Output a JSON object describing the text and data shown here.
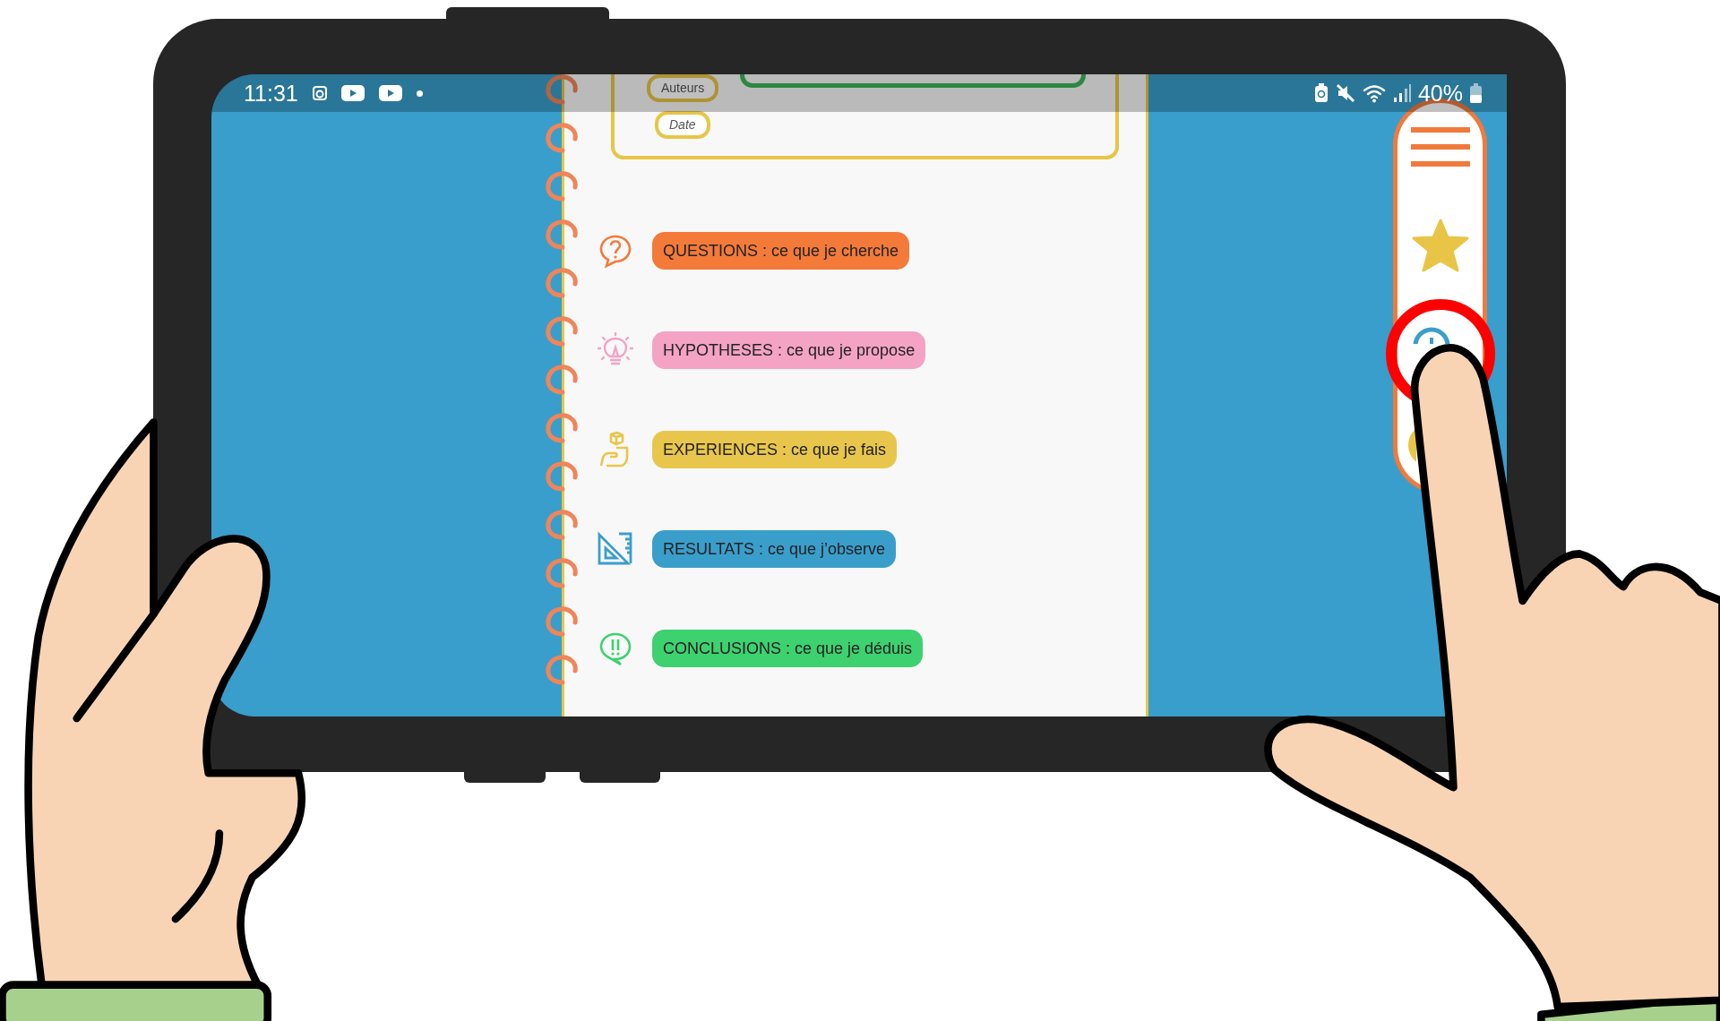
{
  "status_bar": {
    "time": "11:31",
    "battery": "40%"
  },
  "header": {
    "fields": [
      {
        "label": "Auteurs",
        "italic": false
      },
      {
        "label": "Date",
        "italic": true
      }
    ]
  },
  "steps": [
    {
      "kind": "question",
      "label": "QUESTIONS : ce que je cherche",
      "color": "#f47a3a"
    },
    {
      "kind": "idea",
      "label": "HYPOTHESES : ce que je propose",
      "color": "#f4a3c4"
    },
    {
      "kind": "experiment",
      "label": "EXPERIENCES : ce que je fais",
      "color": "#e8c64b"
    },
    {
      "kind": "results",
      "label": "RESULTATS : ce que j’observe",
      "color": "#3a9ecb"
    },
    {
      "kind": "conclusion",
      "label": "CONCLUSIONS : ce que je déduis",
      "color": "#3dd170"
    }
  ],
  "sidebar": {
    "items": [
      {
        "kind": "menu",
        "highlighted": false
      },
      {
        "kind": "star",
        "highlighted": false
      },
      {
        "kind": "add",
        "highlighted": true
      },
      {
        "kind": "circle",
        "highlighted": false
      }
    ]
  }
}
